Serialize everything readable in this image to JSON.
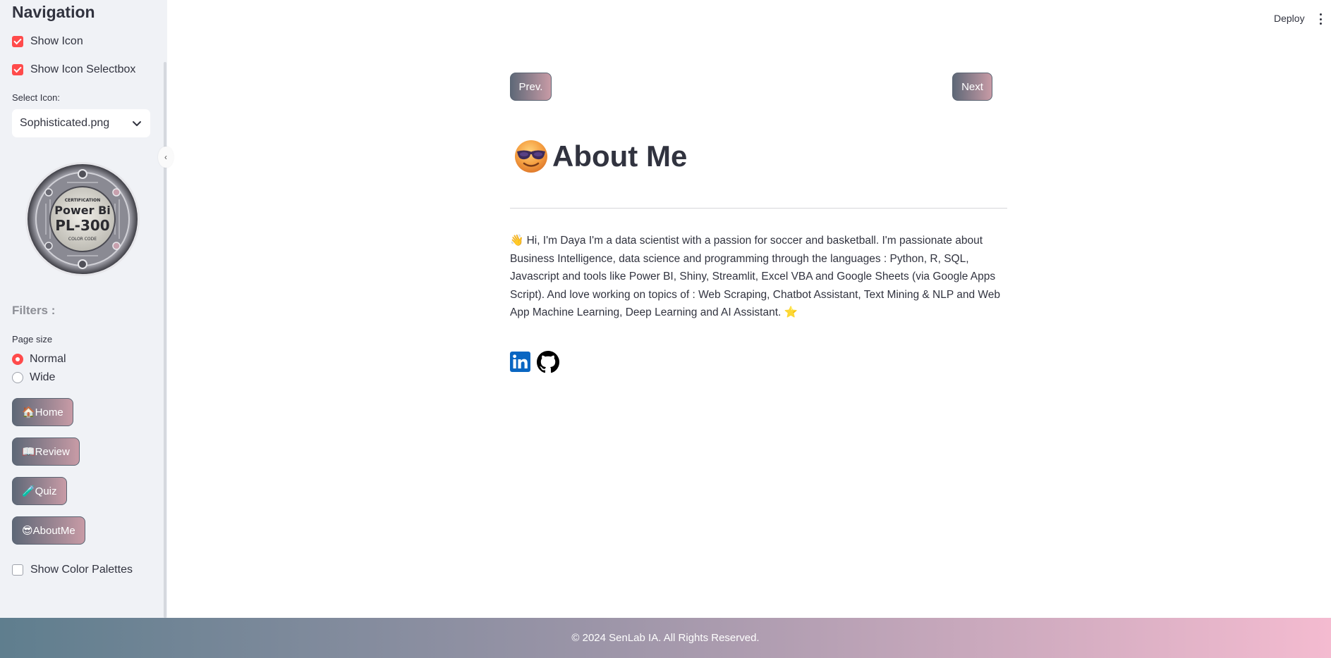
{
  "sidebar": {
    "title": "Navigation",
    "show_icon": {
      "label": "Show Icon",
      "checked": true
    },
    "show_icon_selectbox": {
      "label": "Show Icon Selectbox",
      "checked": true
    },
    "select_icon": {
      "label": "Select Icon:",
      "value": "Sophisticated.png"
    },
    "badge": {
      "line1": "CERTIFICATION",
      "line2": "Power Bi",
      "line3": "PL-300",
      "line4": "COLOR CODE"
    },
    "filters_heading": "Filters :",
    "page_size": {
      "label": "Page size",
      "options": [
        {
          "label": "Normal",
          "selected": true
        },
        {
          "label": "Wide",
          "selected": false
        }
      ]
    },
    "nav_buttons": [
      {
        "label": "🏠Home"
      },
      {
        "label": "📖Review"
      },
      {
        "label": "🧪Quiz"
      },
      {
        "label": "😎AboutMe"
      }
    ],
    "show_color_palettes": {
      "label": "Show Color Palettes",
      "checked": false
    }
  },
  "header": {
    "deploy_label": "Deploy"
  },
  "main": {
    "prev_label": "Prev.",
    "next_label": "Next",
    "title": "About Me",
    "intro": "👋 Hi, I'm Daya I'm a data scientist with a passion for soccer and basketball. I'm passionate about Business Intelligence, data science and programming through the languages : Python, R, SQL, Javascript and tools like Power BI, Shiny, Streamlit, Excel VBA and Google Sheets (via Google Apps Script). And love working on topics of : Web Scraping, Chatbot Assistant, Text Mining & NLP and Web App Machine Learning, Deep Learning and AI Assistant. ⭐",
    "social_icons": [
      "linkedin-icon",
      "github-icon"
    ]
  },
  "footer": {
    "text": "© 2024 SenLab IA. All Rights Reserved."
  },
  "colors": {
    "accent": "#ff4b4b",
    "sidebar_bg": "#f0f2f6",
    "button_gradient_start": "#5e6877",
    "button_gradient_end": "#c89ba6",
    "footer_gradient_start": "#5f7e8e",
    "footer_gradient_end": "#f4bbd0",
    "linkedin_blue": "#0a66c2"
  }
}
